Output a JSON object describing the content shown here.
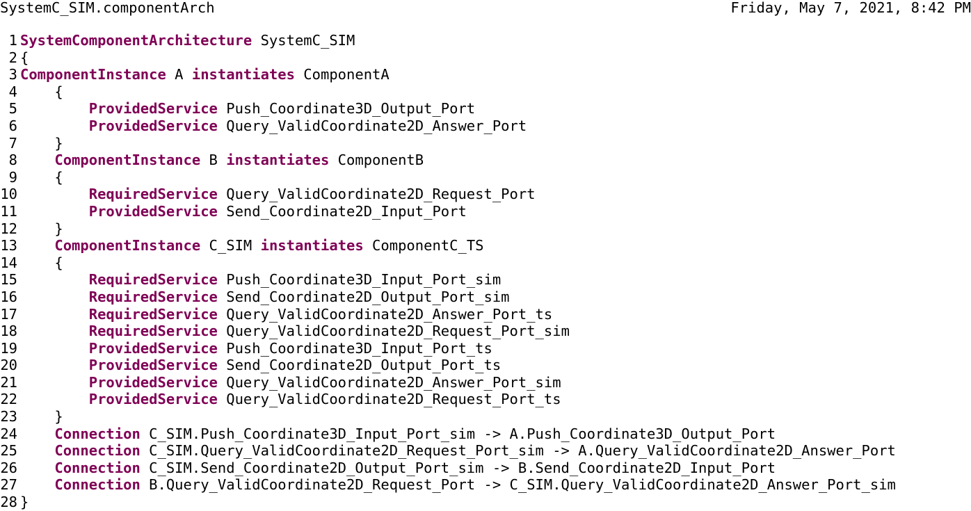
{
  "header": {
    "file_name": "SystemC_SIM.componentArch",
    "date": "Friday, May 7, 2021, 8:42 PM"
  },
  "keyword_color": "#7f0055",
  "lines": [
    {
      "n": "1",
      "tokens": [
        {
          "t": "SystemComponentArchitecture",
          "kw": true
        },
        {
          "t": " SystemC_SIM"
        }
      ]
    },
    {
      "n": "2",
      "tokens": [
        {
          "t": "{"
        }
      ]
    },
    {
      "n": "3",
      "tokens": [
        {
          "t": "ComponentInstance",
          "kw": true
        },
        {
          "t": " A "
        },
        {
          "t": "instantiates",
          "kw": true
        },
        {
          "t": " ComponentA"
        }
      ]
    },
    {
      "n": "4",
      "tokens": [
        {
          "t": "    {"
        }
      ]
    },
    {
      "n": "5",
      "tokens": [
        {
          "t": "        "
        },
        {
          "t": "ProvidedService",
          "kw": true
        },
        {
          "t": " Push_Coordinate3D_Output_Port"
        }
      ]
    },
    {
      "n": "6",
      "tokens": [
        {
          "t": "        "
        },
        {
          "t": "ProvidedService",
          "kw": true
        },
        {
          "t": " Query_ValidCoordinate2D_Answer_Port"
        }
      ]
    },
    {
      "n": "7",
      "tokens": [
        {
          "t": "    }"
        }
      ]
    },
    {
      "n": "8",
      "tokens": [
        {
          "t": "    "
        },
        {
          "t": "ComponentInstance",
          "kw": true
        },
        {
          "t": " B "
        },
        {
          "t": "instantiates",
          "kw": true
        },
        {
          "t": " ComponentB"
        }
      ]
    },
    {
      "n": "9",
      "tokens": [
        {
          "t": "    {"
        }
      ]
    },
    {
      "n": "10",
      "tokens": [
        {
          "t": "        "
        },
        {
          "t": "RequiredService",
          "kw": true
        },
        {
          "t": " Query_ValidCoordinate2D_Request_Port"
        }
      ]
    },
    {
      "n": "11",
      "tokens": [
        {
          "t": "        "
        },
        {
          "t": "ProvidedService",
          "kw": true
        },
        {
          "t": " Send_Coordinate2D_Input_Port"
        }
      ]
    },
    {
      "n": "12",
      "tokens": [
        {
          "t": "    }"
        }
      ]
    },
    {
      "n": "13",
      "tokens": [
        {
          "t": "    "
        },
        {
          "t": "ComponentInstance",
          "kw": true
        },
        {
          "t": " C_SIM "
        },
        {
          "t": "instantiates",
          "kw": true
        },
        {
          "t": " ComponentC_TS"
        }
      ]
    },
    {
      "n": "14",
      "tokens": [
        {
          "t": "    {"
        }
      ]
    },
    {
      "n": "15",
      "tokens": [
        {
          "t": "        "
        },
        {
          "t": "RequiredService",
          "kw": true
        },
        {
          "t": " Push_Coordinate3D_Input_Port_sim"
        }
      ]
    },
    {
      "n": "16",
      "tokens": [
        {
          "t": "        "
        },
        {
          "t": "RequiredService",
          "kw": true
        },
        {
          "t": " Send_Coordinate2D_Output_Port_sim"
        }
      ]
    },
    {
      "n": "17",
      "tokens": [
        {
          "t": "        "
        },
        {
          "t": "RequiredService",
          "kw": true
        },
        {
          "t": " Query_ValidCoordinate2D_Answer_Port_ts"
        }
      ]
    },
    {
      "n": "18",
      "tokens": [
        {
          "t": "        "
        },
        {
          "t": "RequiredService",
          "kw": true
        },
        {
          "t": " Query_ValidCoordinate2D_Request_Port_sim"
        }
      ]
    },
    {
      "n": "19",
      "tokens": [
        {
          "t": "        "
        },
        {
          "t": "ProvidedService",
          "kw": true
        },
        {
          "t": " Push_Coordinate3D_Input_Port_ts"
        }
      ]
    },
    {
      "n": "20",
      "tokens": [
        {
          "t": "        "
        },
        {
          "t": "ProvidedService",
          "kw": true
        },
        {
          "t": " Send_Coordinate2D_Output_Port_ts"
        }
      ]
    },
    {
      "n": "21",
      "tokens": [
        {
          "t": "        "
        },
        {
          "t": "ProvidedService",
          "kw": true
        },
        {
          "t": " Query_ValidCoordinate2D_Answer_Port_sim"
        }
      ]
    },
    {
      "n": "22",
      "tokens": [
        {
          "t": "        "
        },
        {
          "t": "ProvidedService",
          "kw": true
        },
        {
          "t": " Query_ValidCoordinate2D_Request_Port_ts"
        }
      ]
    },
    {
      "n": "23",
      "tokens": [
        {
          "t": "    }"
        }
      ]
    },
    {
      "n": "24",
      "tokens": [
        {
          "t": "    "
        },
        {
          "t": "Connection",
          "kw": true
        },
        {
          "t": " C_SIM.Push_Coordinate3D_Input_Port_sim -> A.Push_Coordinate3D_Output_Port"
        }
      ]
    },
    {
      "n": "25",
      "tokens": [
        {
          "t": "    "
        },
        {
          "t": "Connection",
          "kw": true
        },
        {
          "t": " C_SIM.Query_ValidCoordinate2D_Request_Port_sim -> A.Query_ValidCoordinate2D_Answer_Port"
        }
      ]
    },
    {
      "n": "26",
      "tokens": [
        {
          "t": "    "
        },
        {
          "t": "Connection",
          "kw": true
        },
        {
          "t": " C_SIM.Send_Coordinate2D_Output_Port_sim -> B.Send_Coordinate2D_Input_Port"
        }
      ]
    },
    {
      "n": "27",
      "tokens": [
        {
          "t": "    "
        },
        {
          "t": "Connection",
          "kw": true
        },
        {
          "t": " B.Query_ValidCoordinate2D_Request_Port -> C_SIM.Query_ValidCoordinate2D_Answer_Port_sim"
        }
      ]
    },
    {
      "n": "28",
      "tokens": [
        {
          "t": "}"
        }
      ]
    }
  ]
}
